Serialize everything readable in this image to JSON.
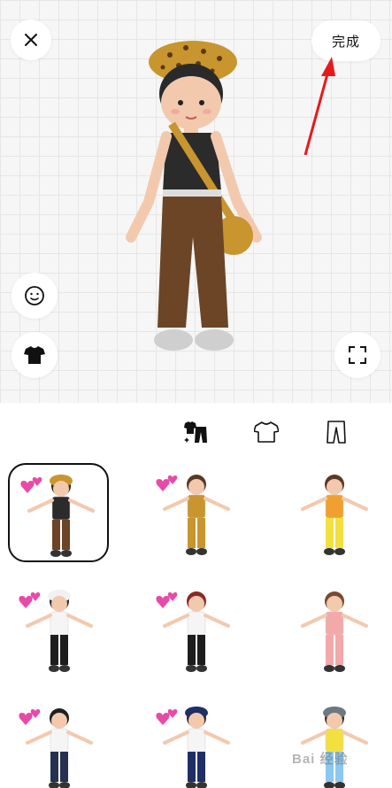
{
  "header": {
    "done_label": "完成"
  },
  "icons": {
    "close": "close-icon",
    "face": "face-icon",
    "shirt": "shirt-icon",
    "fullscreen": "fullscreen-icon"
  },
  "tabs": [
    {
      "name": "outfit-tab",
      "icon": "outfit-icon",
      "active": true
    },
    {
      "name": "top-tab",
      "icon": "tshirt-icon",
      "active": false
    },
    {
      "name": "bottom-tab",
      "icon": "pants-icon",
      "active": false
    }
  ],
  "presets": [
    {
      "id": 1,
      "hearts": true,
      "selected": true,
      "top": "#2b2b2b",
      "bottom": "#6b4526",
      "hat": "#c8952f",
      "hair": "#2a2a2a",
      "skin": "#f3c9ae"
    },
    {
      "id": 2,
      "hearts": true,
      "selected": false,
      "top": "#c8952f",
      "bottom": "#c8952f",
      "hat": null,
      "hair": "#5a3a25",
      "skin": "#f3c9ae"
    },
    {
      "id": 3,
      "hearts": false,
      "selected": false,
      "top": "#f0a030",
      "bottom": "#f2e040",
      "hat": null,
      "hair": "#5a3a25",
      "skin": "#f3c9ae"
    },
    {
      "id": 4,
      "hearts": true,
      "selected": false,
      "top": "#f5f5f5",
      "bottom": "#1d1d1d",
      "hat": "#f1f1f1",
      "hair": "#2a2a2a",
      "skin": "#f3c9ae"
    },
    {
      "id": 5,
      "hearts": true,
      "selected": false,
      "top": "#f5f5f5",
      "bottom": "#1d1d1d",
      "hat": null,
      "hair": "#8a2a20",
      "skin": "#f3c9ae"
    },
    {
      "id": 6,
      "hearts": false,
      "selected": false,
      "top": "#f3a9a9",
      "bottom": "#f3a9a9",
      "hat": null,
      "hair": "#7a4a30",
      "skin": "#f3c9ae"
    },
    {
      "id": 7,
      "hearts": true,
      "selected": false,
      "top": "#f5f5f5",
      "bottom": "#26304f",
      "hat": null,
      "hair": "#1f1f1f",
      "skin": "#f3c9ae"
    },
    {
      "id": 8,
      "hearts": true,
      "selected": false,
      "top": "#f5f5f5",
      "bottom": "#1f2f66",
      "hat": "#1f2f66",
      "hair": "#3b2a20",
      "skin": "#f3c9ae"
    },
    {
      "id": 9,
      "hearts": false,
      "selected": false,
      "top": "#f2e040",
      "bottom": "#8ac8f0",
      "hat": "#6a7a80",
      "hair": "#3b2a20",
      "skin": "#f3c9ae"
    }
  ],
  "watermark": "Bai 经验"
}
